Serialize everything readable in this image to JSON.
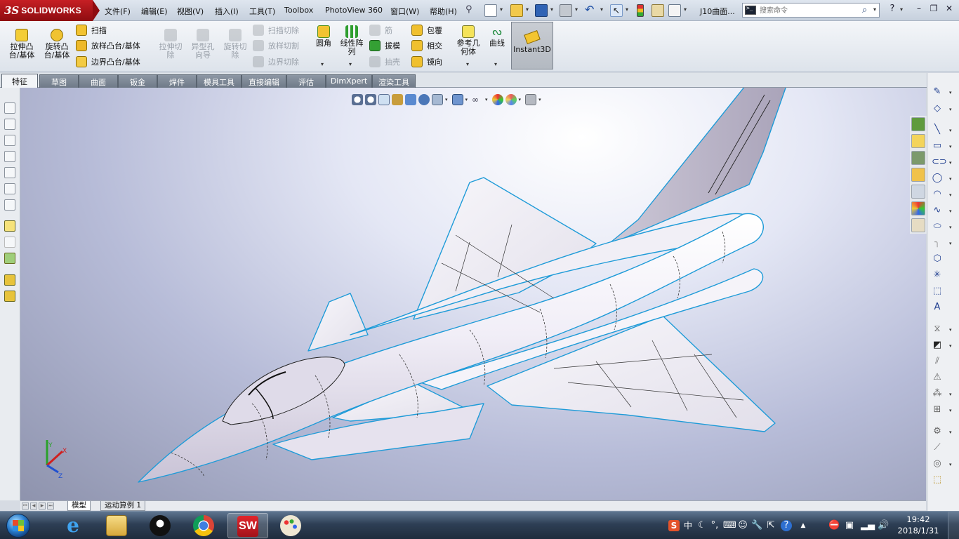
{
  "app": {
    "brand_prefix": "3S",
    "brand_name": "SOLIDWORKS"
  },
  "menu": [
    {
      "label": "文件(F)"
    },
    {
      "label": "编辑(E)"
    },
    {
      "label": "视图(V)"
    },
    {
      "label": "插入(I)"
    },
    {
      "label": "工具(T)"
    },
    {
      "label": "Toolbox"
    },
    {
      "label": "PhotoView 360"
    },
    {
      "label": "窗口(W)"
    },
    {
      "label": "帮助(H)"
    }
  ],
  "document": {
    "title": "J10曲面..."
  },
  "search": {
    "placeholder": "搜索命令"
  },
  "ribbon": {
    "extrude_boss": "拉伸凸\n台/基体",
    "revolve_boss": "旋转凸\n台/基体",
    "sweep": "扫描",
    "loft": "放样凸台/基体",
    "boundary": "边界凸台/基体",
    "extrude_cut": "拉伸切\n除",
    "hole_wizard": "异型孔\n向导",
    "revolve_cut": "旋转切\n除",
    "swept_cut": "扫描切除",
    "lofted_cut": "放样切割",
    "boundary_cut": "边界切除",
    "fillet": "圆角",
    "linear_pattern": "线性阵\n列",
    "rib": "筋",
    "draft": "拔模",
    "shell": "抽壳",
    "wrap": "包覆",
    "intersect": "相交",
    "mirror": "镜向",
    "ref_geometry": "参考几\n何体",
    "curves": "曲线",
    "instant3d": "Instant3D"
  },
  "tabs": [
    {
      "label": "特征",
      "active": true
    },
    {
      "label": "草图"
    },
    {
      "label": "曲面"
    },
    {
      "label": "钣金"
    },
    {
      "label": "焊件"
    },
    {
      "label": "模具工具"
    },
    {
      "label": "直接编辑"
    },
    {
      "label": "评估"
    },
    {
      "label": "DimXpert"
    },
    {
      "label": "渲染工具"
    }
  ],
  "bottom_tabs": [
    {
      "label": "模型",
      "active": true
    },
    {
      "label": "运动算例 1"
    }
  ],
  "triad": {
    "x": "X",
    "y": "Y",
    "z": "Z"
  },
  "taskbar": {
    "apps": [
      {
        "icon": "internet-explorer-icon"
      },
      {
        "icon": "file-explorer-icon"
      },
      {
        "icon": "qq-icon"
      },
      {
        "icon": "chrome-icon"
      },
      {
        "icon": "solidworks-icon",
        "active": true
      },
      {
        "icon": "paint-icon"
      }
    ],
    "ime": "中",
    "time": "19:42",
    "date": "2018/1/31"
  },
  "colors": {
    "accent_red": "#c61f24",
    "model_edge": "#1e9bd8",
    "model_fill": "#ece8f3"
  }
}
